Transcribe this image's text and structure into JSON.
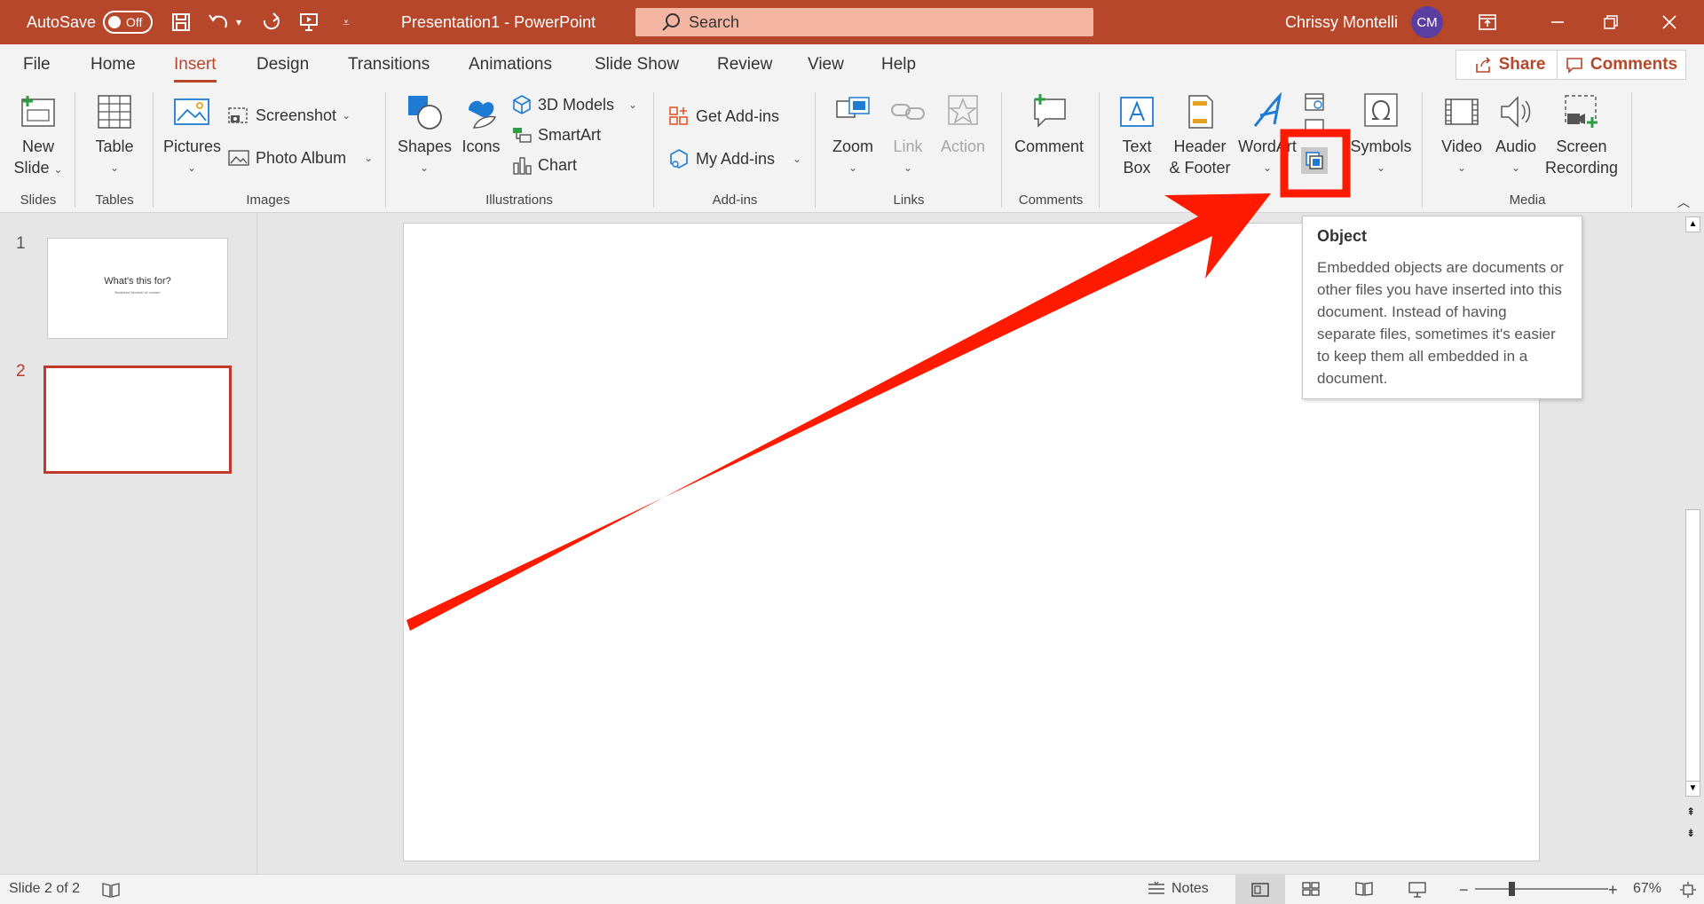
{
  "colors": {
    "accent": "#b7472a",
    "annotation_red": "#ff1a00",
    "avatar": "#5b3fa0"
  },
  "titlebar": {
    "autosave_label": "AutoSave",
    "autosave_state": "Off",
    "document_title": "Presentation1  -  PowerPoint",
    "search_placeholder": "Search",
    "user_name": "Chrissy Montelli",
    "user_initials": "CM"
  },
  "tabs": [
    "File",
    "Home",
    "Insert",
    "Design",
    "Transitions",
    "Animations",
    "Slide Show",
    "Review",
    "View",
    "Help"
  ],
  "active_tab": "Insert",
  "share_label": "Share",
  "comments_label": "Comments",
  "ribbon": {
    "new_slide": [
      "New",
      "Slide"
    ],
    "table": "Table",
    "pictures": "Pictures",
    "screenshot": "Screenshot",
    "photo_album": "Photo Album",
    "shapes": "Shapes",
    "icons": "Icons",
    "models_3d": "3D Models",
    "smartart": "SmartArt",
    "chart": "Chart",
    "get_addins": "Get Add-ins",
    "my_addins": "My Add-ins",
    "zoom": "Zoom",
    "link": "Link",
    "action": "Action",
    "comment": "Comment",
    "text_box": [
      "Text",
      "Box"
    ],
    "header_footer": [
      "Header",
      "& Footer"
    ],
    "wordart": "WordArt",
    "symbols": "Symbols",
    "video": "Video",
    "audio": "Audio",
    "screen_recording": [
      "Screen",
      "Recording"
    ],
    "groups": {
      "slides": "Slides",
      "tables": "Tables",
      "images": "Images",
      "illustrations": "Illustrations",
      "addins": "Add-ins",
      "links": "Links",
      "comments": "Comments",
      "media": "Media"
    }
  },
  "slides": [
    {
      "number": "1",
      "title": "What's this for?",
      "subtitle": "Business! Models! of course!"
    },
    {
      "number": "2",
      "title": "",
      "subtitle": ""
    }
  ],
  "tooltip": {
    "title": "Object",
    "body": "Embedded objects are documents or other files you have inserted into this document. Instead of having separate files, sometimes it's easier to keep them all embedded in a document."
  },
  "statusbar": {
    "slide_info": "Slide 2 of 2",
    "notes": "Notes",
    "zoom": "67%"
  }
}
